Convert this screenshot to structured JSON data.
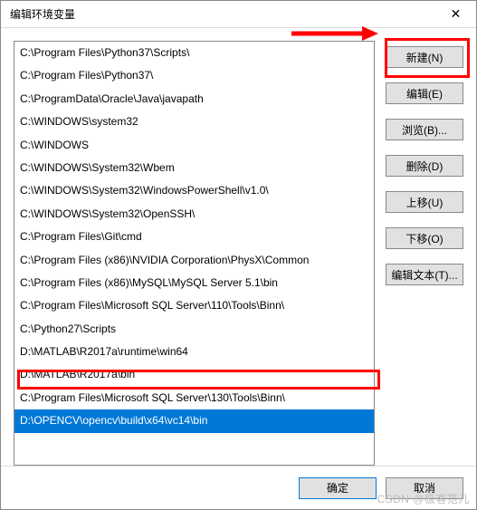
{
  "window": {
    "title": "编辑环境变量",
    "close_glyph": "✕"
  },
  "list": {
    "items": [
      "C:\\Program Files\\Python37\\Scripts\\",
      "C:\\Program Files\\Python37\\",
      "C:\\ProgramData\\Oracle\\Java\\javapath",
      "C:\\WINDOWS\\system32",
      "C:\\WINDOWS",
      "C:\\WINDOWS\\System32\\Wbem",
      "C:\\WINDOWS\\System32\\WindowsPowerShell\\v1.0\\",
      "C:\\WINDOWS\\System32\\OpenSSH\\",
      "C:\\Program Files\\Git\\cmd",
      "C:\\Program Files (x86)\\NVIDIA Corporation\\PhysX\\Common",
      "C:\\Program Files (x86)\\MySQL\\MySQL Server 5.1\\bin",
      "C:\\Program Files\\Microsoft SQL Server\\110\\Tools\\Binn\\",
      "C:\\Python27\\Scripts",
      "D:\\MATLAB\\R2017a\\runtime\\win64",
      "D:\\MATLAB\\R2017a\\bin",
      "C:\\Program Files\\Microsoft SQL Server\\130\\Tools\\Binn\\",
      "D:\\OPENCV\\opencv\\build\\x64\\vc14\\bin"
    ],
    "selected_index": 16
  },
  "buttons": {
    "new": "新建(N)",
    "edit": "编辑(E)",
    "browse": "浏览(B)...",
    "delete": "删除(D)",
    "move_up": "上移(U)",
    "move_down": "下移(O)",
    "edit_text": "编辑文本(T)..."
  },
  "footer": {
    "ok": "确定",
    "cancel": "取消"
  },
  "watermark": "CSDN @极客范儿"
}
